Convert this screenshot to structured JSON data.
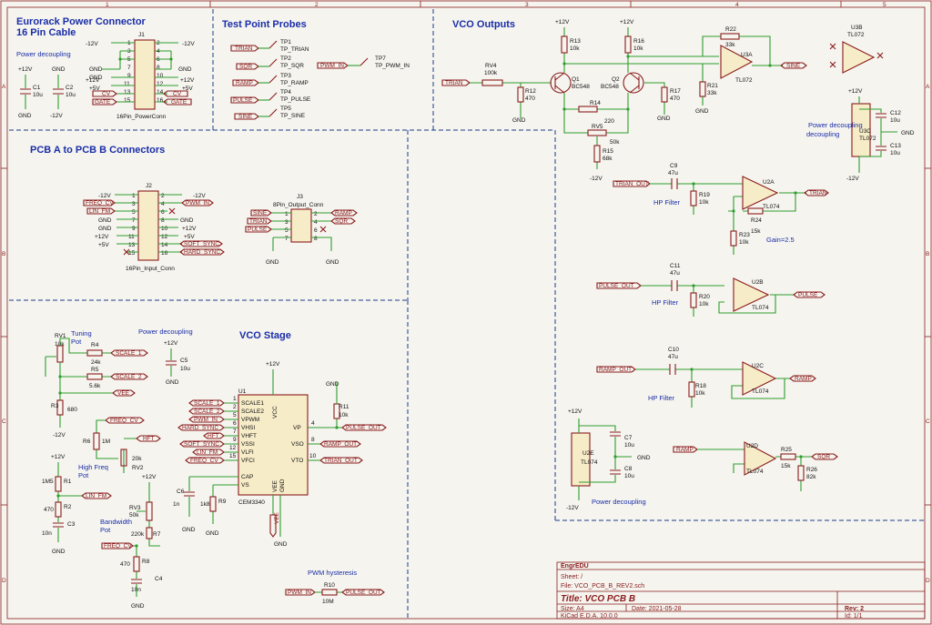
{
  "colors": {
    "wire": "#2e9e2e",
    "component": "#8a1c1c",
    "frame": "#8a1c1c",
    "text": "#1a3a8a",
    "label_text": "#8a1c1c",
    "section": "#1a2ea8",
    "ref": "#111111",
    "bg": "#f5f4ef",
    "fill": "#f7ecc8"
  },
  "frame": {
    "cols": [
      "1",
      "2",
      "3",
      "4",
      "5"
    ],
    "rows": [
      "A",
      "B",
      "C",
      "D"
    ]
  },
  "sections": {
    "eurorack": "Eurorack Power Connector",
    "eurorack_sub": "16 Pin Cable",
    "probes": "Test Point Probes",
    "vco_outputs": "VCO Outputs",
    "pcb": "PCB A to PCB B Connectors",
    "vco_stage": "VCO Stage"
  },
  "notes": {
    "pd1": "Power decoupling",
    "pd2": "Power decoupling",
    "pd3": "Power decoupling",
    "pd4": "Power decoupling",
    "tuning": "Tuning",
    "pot": "Pot",
    "highfreq": "High Freq",
    "pot2": "Pot",
    "bandwidth": "Bandwidth",
    "pot3": "Pot",
    "hp1": "HP Filter",
    "hp2": "HP Filter",
    "hp3": "HP Filter",
    "gain": "Gain=2.5",
    "pwmhyst": "PWM hysteresis"
  },
  "j1": {
    "ref": "J1",
    "value": "16Pin_PowerConn",
    "left_labels": [
      "CV",
      "GATE"
    ],
    "right_labels": [
      "CV",
      "GATE"
    ],
    "left_nets": [
      "-12V",
      "GND",
      "GND",
      "+12V",
      "+5V"
    ],
    "right_nets": [
      "-12V",
      "GND",
      "+12V",
      "+5V"
    ],
    "pins_left": [
      "1",
      "3",
      "5",
      "7",
      "9",
      "11",
      "13",
      "15"
    ],
    "pins_right": [
      "2",
      "4",
      "6",
      "8",
      "10",
      "12",
      "14",
      "16"
    ]
  },
  "j2": {
    "ref": "J2",
    "value": "16Pin_Input_Conn",
    "left": [
      "-12V",
      "FREQ_CV",
      "LIN_FM",
      "GND",
      "GND",
      "+12V",
      "+5V"
    ],
    "right": [
      "-12V",
      "PWM_IN",
      "GND",
      "+12V",
      "+5V",
      "SOFT_SYNC",
      "HARD_SYNC"
    ],
    "pins_left": [
      "1",
      "3",
      "5",
      "7",
      "9",
      "11",
      "13",
      "15"
    ],
    "pins_right": [
      "2",
      "4",
      "6",
      "8",
      "10",
      "12",
      "14",
      "16"
    ]
  },
  "j3": {
    "ref": "J3",
    "value": "8Pin_Output_Conn",
    "left": [
      "SINE",
      "TRIAN",
      "PULSE"
    ],
    "right": [
      "RAMP",
      "SQR"
    ],
    "pins_left": [
      "1",
      "3",
      "5",
      "7"
    ],
    "pins_right": [
      "2",
      "4",
      "6",
      "8"
    ]
  },
  "probes": [
    {
      "label": "TRIAN",
      "ref": "TP1",
      "val": "TP_TRIAN"
    },
    {
      "label": "SQR",
      "ref": "TP2",
      "val": "TP_SQR"
    },
    {
      "label": "RAMP",
      "ref": "TP3",
      "val": "TP_RAMP"
    },
    {
      "label": "PULSE",
      "ref": "TP4",
      "val": "TP_PULSE"
    },
    {
      "label": "SINE",
      "ref": "TP5",
      "val": "TP_SINE"
    }
  ],
  "tp7": {
    "label": "PWM_IN",
    "ref": "TP7",
    "val": "TP_PWM_IN"
  },
  "caps_top": {
    "c1": "C1",
    "c1v": "10u",
    "c2": "C2",
    "c2v": "10u",
    "p12": "+12V",
    "gnd": "GND",
    "m12": "-12V",
    "gnd2": "GND"
  },
  "vco_out": {
    "rv4": "RV4",
    "rv4v": "100k",
    "r12": "R12",
    "r12v": "470",
    "q1": "Q1",
    "q1v": "BC548",
    "q2": "Q2",
    "q2v": "BC548",
    "r13": "R13",
    "r13v": "10k",
    "r16": "R16",
    "r16v": "10k",
    "r17": "R17",
    "r17v": "470",
    "r14": "R14",
    "r14v": "220",
    "rv5": "RV5",
    "rv5v": "50k",
    "r15": "R15",
    "r15v": "68k",
    "r22": "R22",
    "r22v": "33k",
    "r21": "R21",
    "r21v": "33k",
    "u3a": "U3A",
    "u3av": "TL072",
    "u3b": "U3B",
    "u3bv": "TL072",
    "u3c": "U3C",
    "u3cv": "TL072",
    "c12": "C12",
    "c12v": "10u",
    "c13": "C13",
    "c13v": "10u",
    "trian": "TRIAN",
    "sine": "SINE",
    "p12": "+12V",
    "m12": "-12V",
    "gnd": "GND"
  },
  "filters": {
    "c9": "C9",
    "c9v": "47u",
    "r19": "R19",
    "r19v": "10k",
    "u2a": "U2A",
    "u2av": "TL074",
    "r24": "R24",
    "r24v": "15k",
    "r23": "R23",
    "r23v": "10k",
    "c11": "C11",
    "c11v": "47u",
    "r20": "R20",
    "r20v": "10k",
    "u2b": "U2B",
    "u2bv": "TL074",
    "c10": "C10",
    "c10v": "47u",
    "r18": "R18",
    "r18v": "10k",
    "u2c": "U2C",
    "u2cv": "TL074",
    "u2d": "U2D",
    "u2dv": "TL074",
    "r25": "R25",
    "r25v": "15k",
    "r26": "R26",
    "r26v": "82k",
    "u2e": "U2E",
    "u2ev": "TL074",
    "c7": "C7",
    "c7v": "10u",
    "c8": "C8",
    "c8v": "10u",
    "trian_out": "TRIAN_OUT",
    "pulse_out": "PULSE_OUT",
    "ramp_out": "RAMP_OUT",
    "trian": "TRIAN",
    "pulse": "PULSE",
    "ramp": "RAMP",
    "sqr": "SQR"
  },
  "vco_stage": {
    "rv1": "RV1",
    "rv1v": "10k",
    "r4": "R4",
    "r4v": "24k",
    "r5": "R5",
    "r5v": "5.6k",
    "r3": "R3",
    "r3v": "680",
    "scale1": "SCALE_1",
    "scale2": "SCALE_2",
    "vee": "VEE",
    "m12": "-12V",
    "freq_cv": "FREQ_CV",
    "lin_fm": "LIN_FM",
    "r6": "R6",
    "r6v": "1M",
    "rv2": "RV2",
    "rv2v": "20k",
    "hft": "HFT",
    "r1": "R1",
    "r1v": "1M5",
    "r2": "R2",
    "r2v": "470",
    "c3": "C3",
    "c3v": "10n",
    "rv3": "RV3",
    "rv3v": "50k",
    "r7": "R7",
    "r7v": "220k",
    "r8": "R8",
    "r8v": "470",
    "c4": "C4",
    "c4v": "10n",
    "c5": "C5",
    "c5v": "10u",
    "u1": "U1",
    "u1v": "CEM3340",
    "c6": "C6",
    "c6v": "1n",
    "r9": "R9",
    "r9v": "1k8",
    "r11": "R11",
    "r11v": "10k",
    "r10": "R10",
    "r10v": "10M",
    "in_labels": [
      "SCALE_1",
      "SCALE_2",
      "PWM_IN",
      "HARD_SYNC",
      "HFT",
      "SOFT_SYNC",
      "LIN_FM",
      "FREQ_CV"
    ],
    "pins_left": [
      "SCALE1",
      "SCALE2",
      "VPWM",
      "VHSI",
      "VHFT",
      "VSSI",
      "VLFI",
      "VFCI"
    ],
    "pin_nums_left": [
      "1",
      "2",
      "5",
      "6",
      "7",
      "9",
      "12",
      "15"
    ],
    "pins_right": [
      "VP",
      "VSO",
      "VTO"
    ],
    "pin_nums_right": [
      "4",
      "8",
      "10"
    ],
    "cap": "CAP",
    "vs": "VS",
    "vcc": "VCC",
    "vee_pin": "VEE",
    "gnd_pin": "GND",
    "pulse_out": "PULSE_OUT",
    "ramp_out": "RAMP_OUT",
    "trian_out": "TRIAN_OUT",
    "pwm_in": "PWM_IN",
    "p12": "+12V",
    "gnd": "GND"
  },
  "title_block": {
    "company": "EngrEDU",
    "sheet": "Sheet: /",
    "file": "File: VCO_PCB_B_REV2.sch",
    "title": "Title: VCO PCB B",
    "size": "Size: A4",
    "date": "Date: 2021-05-28",
    "rev": "Rev: 2",
    "kicad": "KiCad E.D.A. 10.0.0",
    "id": "Id: 1/1"
  }
}
